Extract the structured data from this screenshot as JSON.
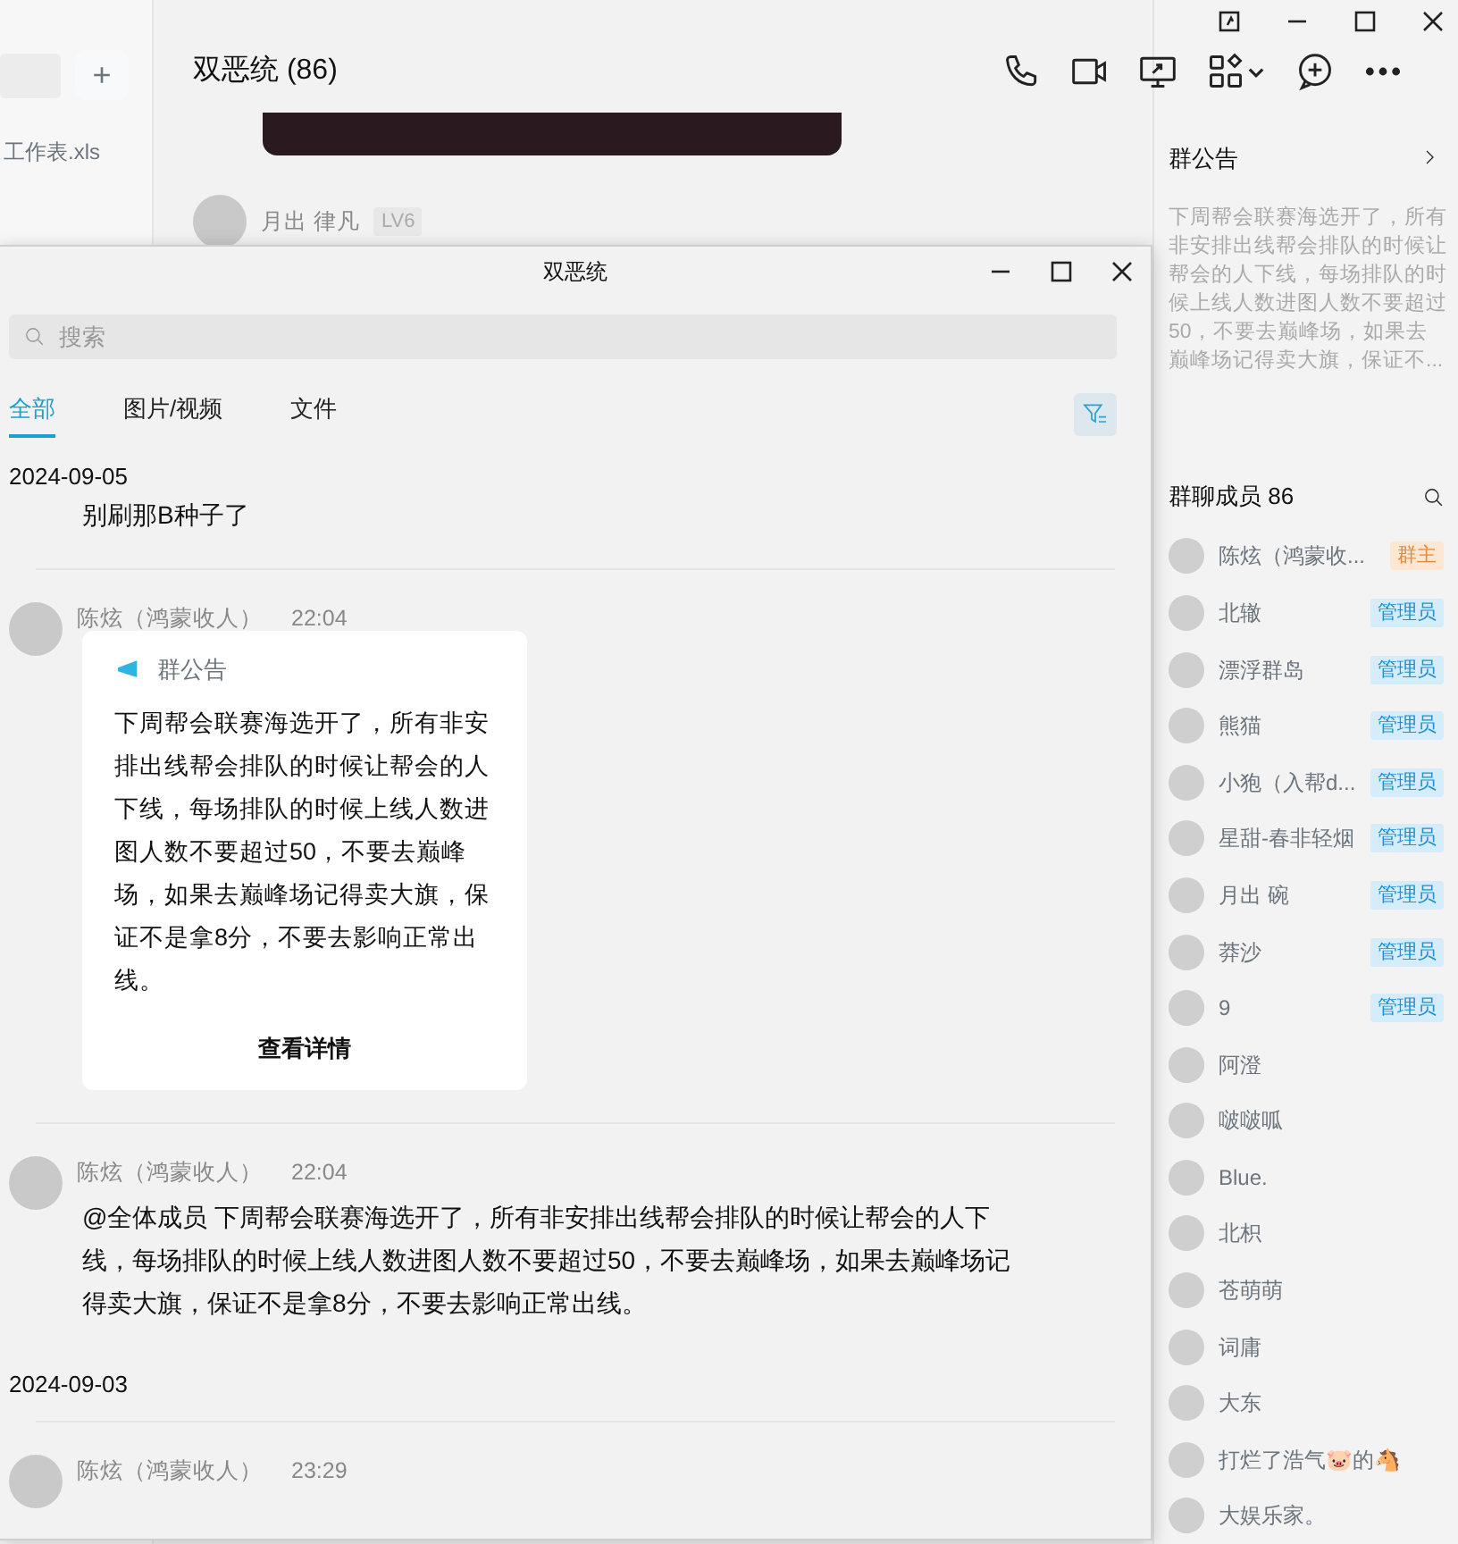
{
  "sidebar": {
    "add_button": "+",
    "items": [
      {
        "text": "工作表.xls"
      }
    ]
  },
  "chat": {
    "title": "双恶统 (86)",
    "last_message": {
      "sender": "月出 律凡",
      "tag": "LV6"
    }
  },
  "announcement": {
    "title": "群公告",
    "text": "下周帮会联赛海选开了，所有非安排出线帮会排队的时候让帮会的人下线，每场排队的时候上线人数进图人数不要超过50，不要去巅峰场，如果去巅峰场记得卖大旗，保证不..."
  },
  "members": {
    "title": "群聊成员 86",
    "list": [
      {
        "name": "陈炫（鸿蒙收...",
        "kind": "owner",
        "badge": "群主"
      },
      {
        "name": "北辙",
        "kind": "admin",
        "badge": "管理员"
      },
      {
        "name": "漂浮群岛",
        "kind": "admin",
        "badge": "管理员"
      },
      {
        "name": "熊猫",
        "kind": "admin",
        "badge": "管理员"
      },
      {
        "name": "小狍（入帮d...",
        "kind": "admin",
        "badge": "管理员"
      },
      {
        "name": "星甜-春非轻烟",
        "kind": "admin",
        "badge": "管理员"
      },
      {
        "name": "月出 碗",
        "kind": "admin",
        "badge": "管理员"
      },
      {
        "name": "莽沙",
        "kind": "admin",
        "badge": "管理员"
      },
      {
        "name": "9",
        "kind": "admin",
        "badge": "管理员"
      },
      {
        "name": "阿澄",
        "kind": "member"
      },
      {
        "name": "啵啵呱",
        "kind": "member"
      },
      {
        "name": "Blue.",
        "kind": "member"
      },
      {
        "name": "北枳",
        "kind": "member"
      },
      {
        "name": "苍萌萌",
        "kind": "member"
      },
      {
        "name": "词庸",
        "kind": "member"
      },
      {
        "name": "大东",
        "kind": "member"
      },
      {
        "name": "打烂了浩气🐷的🐴",
        "kind": "member"
      },
      {
        "name": "大娱乐家。",
        "kind": "member"
      }
    ]
  },
  "history_window": {
    "title": "双恶统",
    "search": {
      "placeholder": "搜索"
    },
    "tabs": [
      {
        "label": "全部",
        "selected": true
      },
      {
        "label": "图片/视频",
        "selected": false
      },
      {
        "label": "文件",
        "selected": false
      }
    ],
    "groups": [
      {
        "date": "2024-09-05",
        "messages": [
          {
            "kind": "text",
            "text": "别刷那B种子了"
          },
          {
            "kind": "notice",
            "sender": "陈炫（鸿蒙收人）",
            "time": "22:04",
            "notice_title": "群公告",
            "text": "下周帮会联赛海选开了，所有非安排出线帮会排队的时候让帮会的人下线，每场排队的时候上线人数进图人数不要超过50，不要去巅峰场，如果去巅峰场记得卖大旗，保证不是拿8分，不要去影响正常出线。",
            "link": "查看详情"
          },
          {
            "kind": "text",
            "sender": "陈炫（鸿蒙收人）",
            "time": "22:04",
            "text": "@全体成员 下周帮会联赛海选开了，所有非安排出线帮会排队的时候让帮会的人下线，每场排队的时候上线人数进图人数不要超过50，不要去巅峰场，如果去巅峰场记得卖大旗，保证不是拿8分，不要去影响正常出线。"
          }
        ]
      },
      {
        "date": "2024-09-03",
        "messages": [
          {
            "kind": "text",
            "sender": "陈炫（鸿蒙收人）",
            "time": "23:29"
          }
        ]
      }
    ]
  }
}
